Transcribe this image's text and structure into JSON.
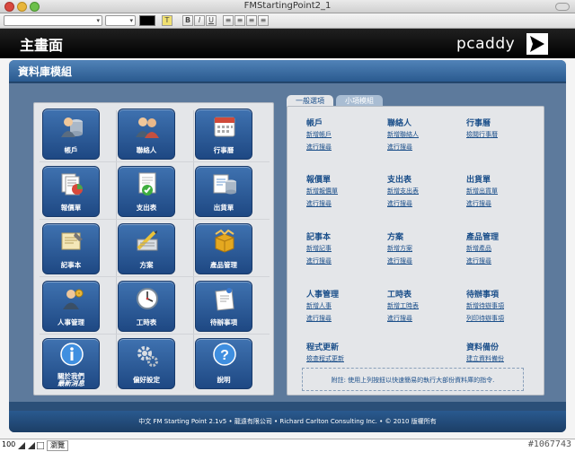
{
  "window": {
    "title": "FMStartingPoint2_1"
  },
  "status_bar": {
    "zoom": "100",
    "mode": "瀏覽",
    "watermark": "#1067743"
  },
  "header": {
    "title": "主畫面",
    "brand": "pcaddy"
  },
  "section": {
    "title": "資料庫模組"
  },
  "tiles": [
    {
      "label": "帳戶",
      "icon": "accounts-icon"
    },
    {
      "label": "聯絡人",
      "icon": "contacts-icon"
    },
    {
      "label": "行事曆",
      "icon": "calendar-icon"
    },
    {
      "label": "報價單",
      "icon": "quotes-icon"
    },
    {
      "label": "支出表",
      "icon": "expenses-icon"
    },
    {
      "label": "出貨單",
      "icon": "invoices-icon"
    },
    {
      "label": "記事本",
      "icon": "notes-icon"
    },
    {
      "label": "方案",
      "icon": "projects-icon"
    },
    {
      "label": "產品管理",
      "icon": "products-icon"
    },
    {
      "label": "人事管理",
      "icon": "personnel-icon"
    },
    {
      "label": "工時表",
      "icon": "timesheet-icon"
    },
    {
      "label": "待辦事項",
      "icon": "todo-icon"
    },
    {
      "label": "關於我們",
      "label2": "最新消息",
      "icon": "about-icon"
    },
    {
      "label": "偏好設定",
      "icon": "preferences-icon"
    },
    {
      "label": "說明",
      "icon": "help-icon"
    }
  ],
  "tabs": [
    {
      "label": "一般選項"
    },
    {
      "label": "小項模組"
    }
  ],
  "groups": [
    {
      "title": "帳戶",
      "links": [
        "新增帳戶",
        "進行搜尋"
      ]
    },
    {
      "title": "聯絡人",
      "links": [
        "新增聯絡人",
        "進行搜尋"
      ]
    },
    {
      "title": "行事曆",
      "links": [
        "檢閱行事曆"
      ]
    },
    {
      "title": "報價單",
      "links": [
        "新增報價單",
        "進行搜尋"
      ]
    },
    {
      "title": "支出表",
      "links": [
        "新增支出表",
        "進行搜尋"
      ]
    },
    {
      "title": "出貨單",
      "links": [
        "新增出貨單",
        "進行搜尋"
      ]
    },
    {
      "title": "記事本",
      "links": [
        "新增記事",
        "進行搜尋"
      ]
    },
    {
      "title": "方案",
      "links": [
        "新增方案",
        "進行搜尋"
      ]
    },
    {
      "title": "產品管理",
      "links": [
        "新增產品",
        "進行搜尋"
      ]
    },
    {
      "title": "人事管理",
      "links": [
        "新增人事",
        "進行搜尋"
      ]
    },
    {
      "title": "工時表",
      "links": [
        "新增工時表",
        "進行搜尋"
      ]
    },
    {
      "title": "待辦事項",
      "links": [
        "新增待辦事項",
        "列印待辦事項"
      ]
    },
    {
      "title": "程式更新",
      "links": [
        "檢查程式更新"
      ]
    },
    {
      "title": "資料備份",
      "links": [
        "建立資料備份"
      ]
    }
  ],
  "note": "附註: 使用上列按鈕以快速簡易的執行大部份資料庫的指令.",
  "footer": "中文 FM Starting Point 2.1v5  •  龍遠有限公司  •  Richard Carlton Consulting Inc.  •  © 2010 版權所有"
}
